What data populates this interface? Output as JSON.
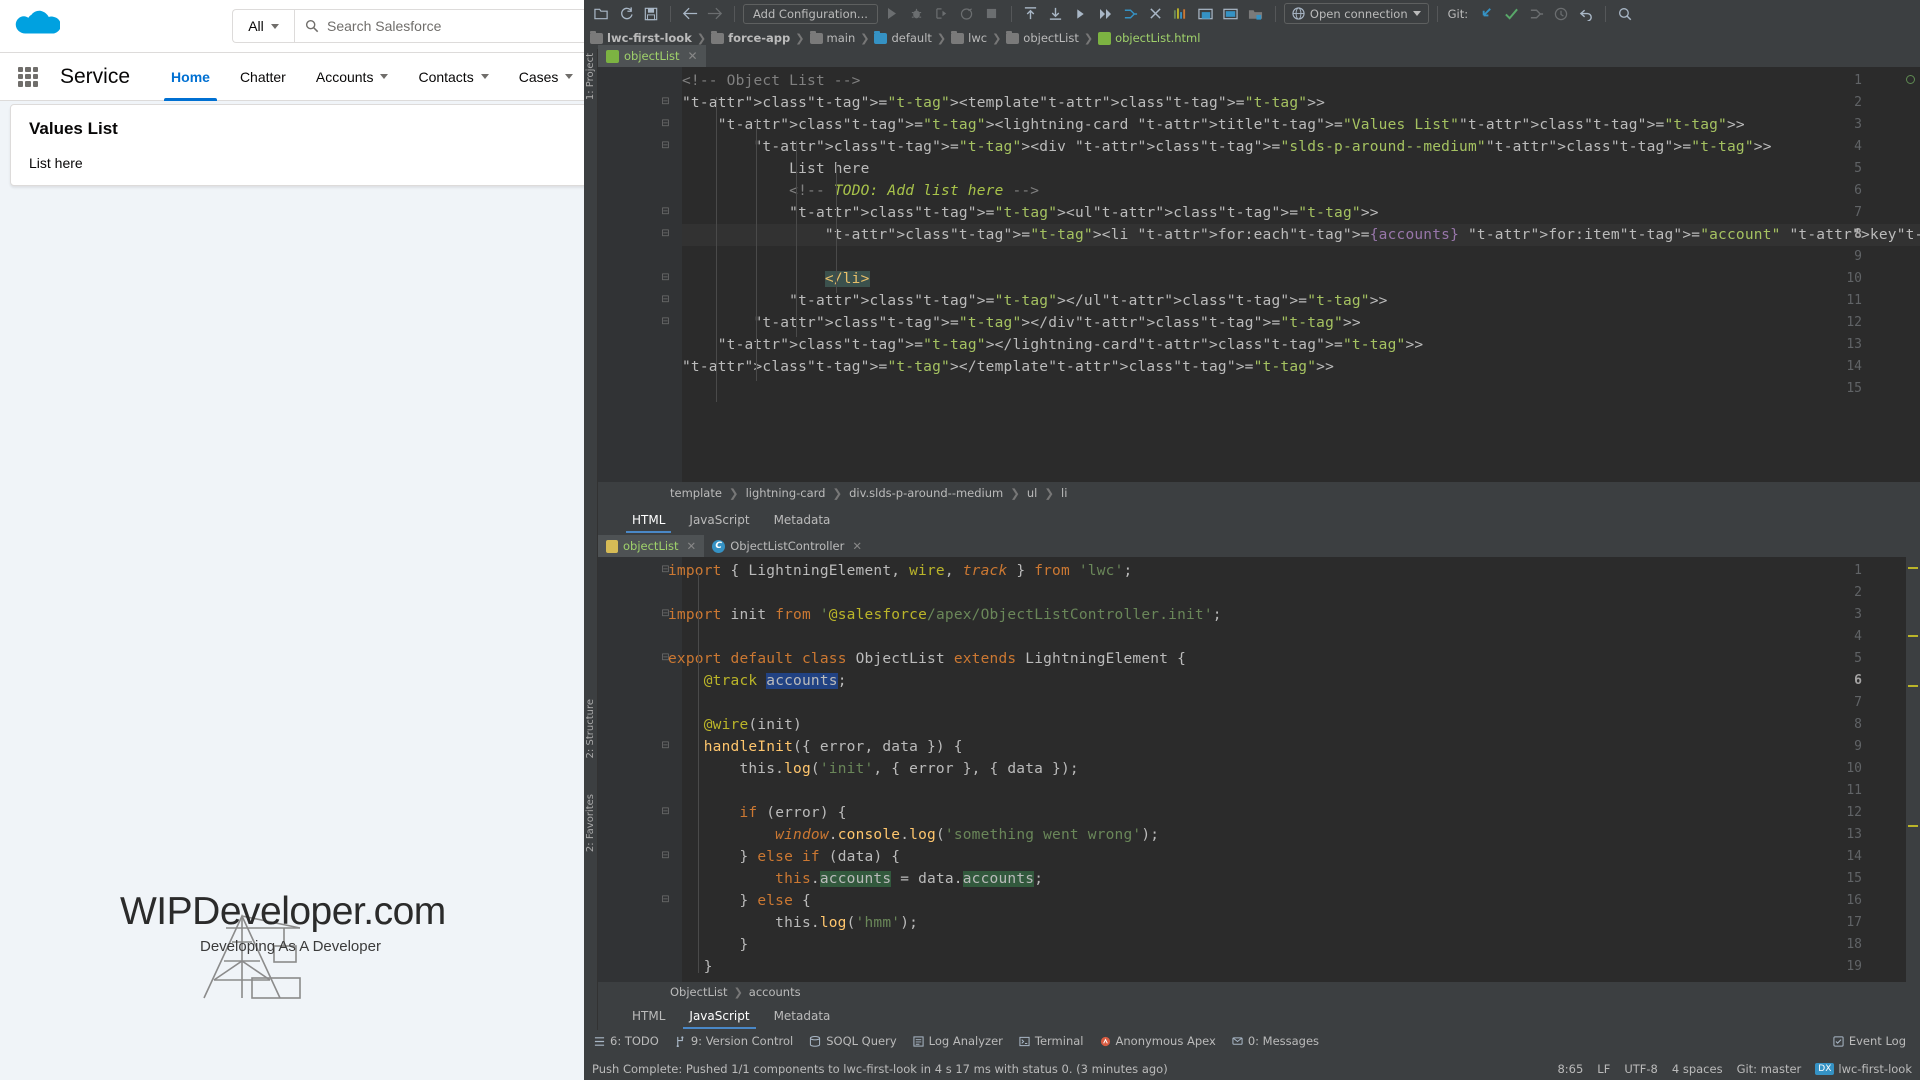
{
  "salesforce": {
    "search": {
      "scope": "All",
      "placeholder": "Search Salesforce"
    },
    "app_name": "Service",
    "nav_tabs": [
      {
        "label": "Home",
        "active": true,
        "caret": false
      },
      {
        "label": "Chatter",
        "active": false,
        "caret": false
      },
      {
        "label": "Accounts",
        "active": false,
        "caret": true
      },
      {
        "label": "Contacts",
        "active": false,
        "caret": true
      },
      {
        "label": "Cases",
        "active": false,
        "caret": true
      }
    ],
    "card": {
      "title": "Values List",
      "body": "List here"
    },
    "watermark": {
      "title": "WIPDeveloper.com",
      "subtitle": "Developing As A Developer"
    }
  },
  "ide": {
    "toolbar": {
      "add_configuration": "Add Configuration...",
      "open_connection": "Open connection",
      "git_label": "Git:"
    },
    "breadcrumb": [
      {
        "label": "lwc-first-look",
        "icon": "folder-icon",
        "bold": true
      },
      {
        "label": "force-app",
        "icon": "folder-icon",
        "bold": true
      },
      {
        "label": "main",
        "icon": "folder-icon",
        "bold": false
      },
      {
        "label": "default",
        "icon": "folder-icon-blue",
        "bold": false
      },
      {
        "label": "lwc",
        "icon": "folder-icon",
        "bold": false
      },
      {
        "label": "objectList",
        "icon": "folder-icon",
        "bold": false
      },
      {
        "label": "objectList.html",
        "icon": "html-file-icon",
        "bold": false
      }
    ],
    "left_strip": [
      {
        "label": "1: Project"
      },
      {
        "label": "2: Structure"
      },
      {
        "label": "2: Favorites"
      }
    ],
    "html_editor": {
      "tab_label": "objectList",
      "current_line": 8,
      "lines": [
        {
          "n": 1,
          "fold": "",
          "text": "<!-- Object List -->"
        },
        {
          "n": 2,
          "fold": "-",
          "text": "<template>"
        },
        {
          "n": 3,
          "fold": "-",
          "text": "    <lightning-card title=\"Values List\">"
        },
        {
          "n": 4,
          "fold": "-",
          "text": "        <div class=\"slds-p-around--medium\">"
        },
        {
          "n": 5,
          "fold": "",
          "text": "            List here"
        },
        {
          "n": 6,
          "fold": "",
          "text": "            <!-- TODO: Add list here -->"
        },
        {
          "n": 7,
          "fold": "-",
          "text": "            <ul>"
        },
        {
          "n": 8,
          "fold": "-",
          "text": "                <li for:each={accounts} for:item=\"account\" key={}>"
        },
        {
          "n": 9,
          "fold": "",
          "text": ""
        },
        {
          "n": 10,
          "fold": "-",
          "text": "                </li>"
        },
        {
          "n": 11,
          "fold": "-",
          "text": "            </ul>"
        },
        {
          "n": 12,
          "fold": "-",
          "text": "        </div>"
        },
        {
          "n": 13,
          "fold": "",
          "text": "    </lightning-card>"
        },
        {
          "n": 14,
          "fold": "",
          "text": "</template>"
        },
        {
          "n": 15,
          "fold": "",
          "text": ""
        }
      ],
      "structure_breadcrumb": [
        "template",
        "lightning-card",
        "div.slds-p-around--medium",
        "ul",
        "li"
      ]
    },
    "upper_file_tabs": [
      {
        "label": "HTML",
        "active": true
      },
      {
        "label": "JavaScript",
        "active": false
      },
      {
        "label": "Metadata",
        "active": false
      }
    ],
    "js_editor": {
      "tabs": [
        {
          "label": "objectList",
          "icon": "js-file-icon",
          "active": true
        },
        {
          "label": "ObjectListController",
          "icon": "apex-class-icon",
          "active": false
        }
      ],
      "current_line": 6,
      "lines": [
        {
          "n": 1,
          "fold": "-",
          "text": "import { LightningElement, wire, track } from 'lwc';"
        },
        {
          "n": 2,
          "fold": "",
          "text": ""
        },
        {
          "n": 3,
          "fold": "-",
          "text": "import init from '@salesforce/apex/ObjectListController.init';"
        },
        {
          "n": 4,
          "fold": "",
          "text": ""
        },
        {
          "n": 5,
          "fold": "-",
          "text": "export default class ObjectList extends LightningElement {"
        },
        {
          "n": 6,
          "fold": "",
          "text": "    @track accounts;"
        },
        {
          "n": 7,
          "fold": "",
          "text": ""
        },
        {
          "n": 8,
          "fold": "",
          "text": "    @wire(init)"
        },
        {
          "n": 9,
          "fold": "-",
          "text": "    handleInit({ error, data }) {"
        },
        {
          "n": 10,
          "fold": "",
          "text": "        this.log('init', { error }, { data });"
        },
        {
          "n": 11,
          "fold": "",
          "text": ""
        },
        {
          "n": 12,
          "fold": "-",
          "text": "        if (error) {"
        },
        {
          "n": 13,
          "fold": "",
          "text": "            window.console.log('something went wrong');"
        },
        {
          "n": 14,
          "fold": "-",
          "text": "        } else if (data) {"
        },
        {
          "n": 15,
          "fold": "",
          "text": "            this.accounts = data.accounts;"
        },
        {
          "n": 16,
          "fold": "-",
          "text": "        } else {"
        },
        {
          "n": 17,
          "fold": "",
          "text": "            this.log('hmm');"
        },
        {
          "n": 18,
          "fold": "",
          "text": "        }"
        },
        {
          "n": 19,
          "fold": "",
          "text": "    }"
        }
      ],
      "structure_breadcrumb": [
        "ObjectList",
        "accounts"
      ]
    },
    "lower_file_tabs": [
      {
        "label": "HTML",
        "active": false
      },
      {
        "label": "JavaScript",
        "active": true
      },
      {
        "label": "Metadata",
        "active": false
      }
    ],
    "tool_windows": [
      {
        "label": "6: TODO",
        "icon": "todo-icon"
      },
      {
        "label": "9: Version Control",
        "icon": "branch-icon"
      },
      {
        "label": "SOQL Query",
        "icon": "soql-icon"
      },
      {
        "label": "Log Analyzer",
        "icon": "log-icon"
      },
      {
        "label": "Terminal",
        "icon": "terminal-icon"
      },
      {
        "label": "Anonymous Apex",
        "icon": "apex-icon"
      },
      {
        "label": "0: Messages",
        "icon": "messages-icon"
      }
    ],
    "event_log": "Event Log",
    "status_message": "Push Complete: Pushed 1/1 components to lwc-first-look in 4 s 17 ms with status 0. (3 minutes ago)",
    "status_right": {
      "caret": "8:65",
      "line_sep": "LF",
      "encoding": "UTF-8",
      "indent": "4 spaces",
      "git_branch": "Git: master",
      "dx_badge": "DX",
      "dx_org": "lwc-first-look"
    }
  },
  "colors": {
    "accent_blue": "#0070d2",
    "ide_bg": "#3c3f41",
    "editor_bg": "#2b2b2b",
    "tab_green": "#a0d26b"
  }
}
